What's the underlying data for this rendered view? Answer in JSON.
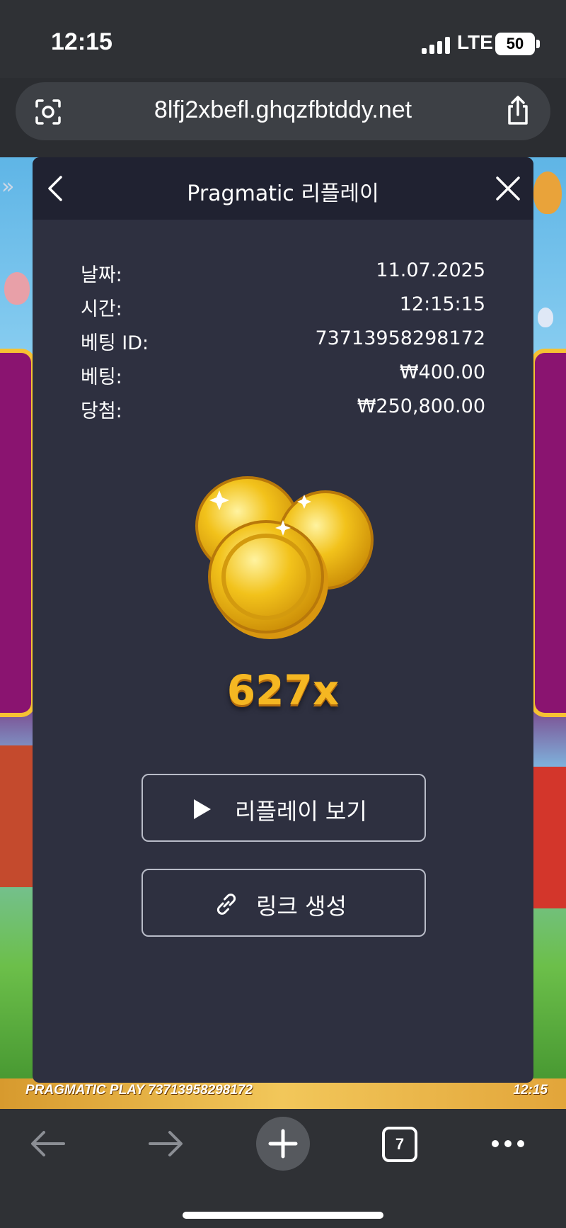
{
  "status_bar": {
    "time": "12:15",
    "network": "LTE",
    "battery": "50"
  },
  "browser": {
    "url": "8lfj2xbefl.ghqzfbtddy.net",
    "tab_count": "7"
  },
  "game": {
    "footer_left": "PRAGMATIC PLAY  73713958298172",
    "footer_right": "12:15"
  },
  "modal": {
    "title": "Pragmatic 리플레이",
    "rows": [
      {
        "label": "날짜:",
        "value": "11.07.2025"
      },
      {
        "label": "시간:",
        "value": "12:15:15"
      },
      {
        "label": "베팅 ID:",
        "value": "73713958298172"
      },
      {
        "label": "베팅:",
        "value": "₩400.00"
      },
      {
        "label": "당첨:",
        "value": "₩250,800.00"
      }
    ],
    "multiplier": "627x",
    "replay_button": "리플레이 보기",
    "link_button": "링크 생성"
  },
  "icons": [
    "lens-icon",
    "share-icon",
    "back-icon",
    "close-icon",
    "coins-icon",
    "play-icon",
    "chain-link-icon",
    "arrow-left-icon",
    "arrow-right-icon",
    "plus-icon",
    "more-icon"
  ],
  "colors": {
    "modal_bg": "#2e3040",
    "header_bg": "#202231",
    "multiplier": "#f5b722",
    "coin": "#f2c21b"
  }
}
